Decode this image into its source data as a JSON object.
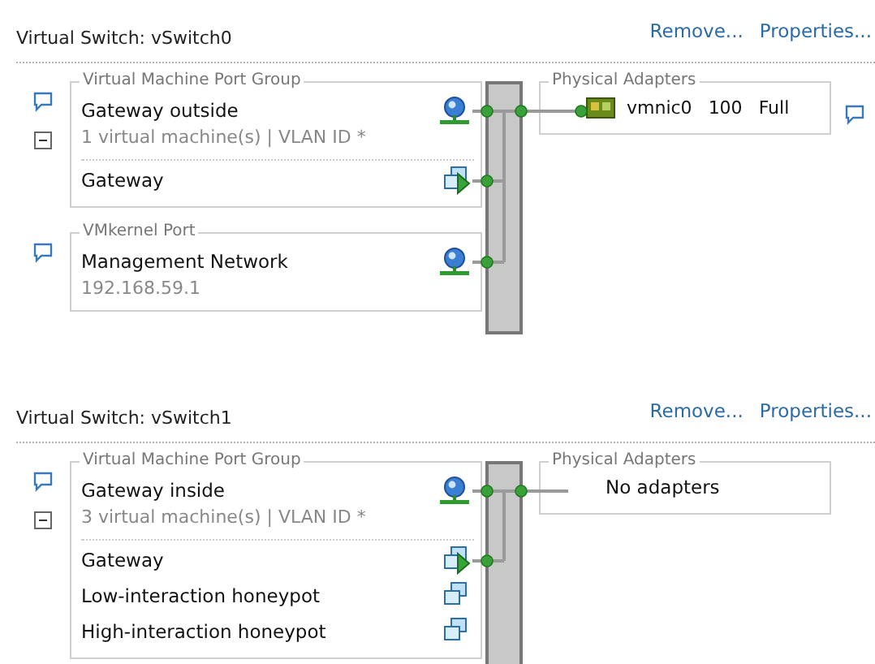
{
  "switches": [
    {
      "title": "Virtual Switch: vSwitch0",
      "actions": [
        "Remove...",
        "Properties..."
      ],
      "port_groups": [
        {
          "kind": "vm",
          "label": "Virtual Machine Port Group",
          "name": "Gateway outside",
          "summary": "1 virtual machine(s) | VLAN ID *",
          "expanded": true,
          "vms": [
            {
              "name": "Gateway",
              "powered_on": true
            }
          ]
        },
        {
          "kind": "vmkernel",
          "label": "VMkernel Port",
          "name": "Management Network",
          "address": "192.168.59.1"
        }
      ],
      "adapters": {
        "label": "Physical Adapters",
        "items": [
          {
            "name": "vmnic0",
            "speed": "100",
            "duplex": "Full"
          }
        ]
      }
    },
    {
      "title": "Virtual Switch: vSwitch1",
      "actions": [
        "Remove...",
        "Properties..."
      ],
      "port_groups": [
        {
          "kind": "vm",
          "label": "Virtual Machine Port Group",
          "name": "Gateway inside",
          "summary": "3 virtual machine(s) | VLAN ID *",
          "expanded": true,
          "vms": [
            {
              "name": "Gateway",
              "powered_on": true
            },
            {
              "name": "Low-interaction honeypot",
              "powered_on": false
            },
            {
              "name": "High-interaction honeypot",
              "powered_on": false
            }
          ]
        }
      ],
      "adapters": {
        "label": "Physical Adapters",
        "empty_text": "No adapters"
      }
    }
  ]
}
